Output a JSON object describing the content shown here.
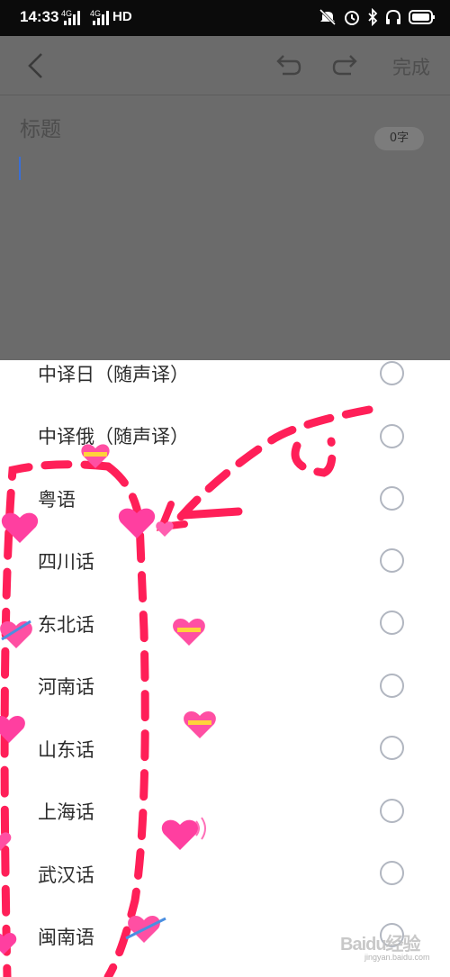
{
  "status_bar": {
    "time": "14:33",
    "network_1": "4G",
    "network_2": "4G",
    "hd_label": "HD"
  },
  "editor": {
    "done_label": "完成",
    "title_placeholder": "标题",
    "char_count": "0字"
  },
  "options": [
    {
      "label": "中译日（随声译）",
      "selected": false
    },
    {
      "label": "中译俄（随声译）",
      "selected": false
    },
    {
      "label": "粤语",
      "selected": false
    },
    {
      "label": "四川话",
      "selected": false
    },
    {
      "label": "东北话",
      "selected": false
    },
    {
      "label": "河南话",
      "selected": false
    },
    {
      "label": "山东话",
      "selected": false
    },
    {
      "label": "上海话",
      "selected": false
    },
    {
      "label": "武汉话",
      "selected": false
    },
    {
      "label": "闽南语",
      "selected": false
    }
  ],
  "watermark": {
    "main": "Baidu经验",
    "sub": "jingyan.baidu.com"
  },
  "colors": {
    "annotation_red": "#ff1f58",
    "radio_border": "#b1b6c0",
    "heart_pink": "#ff4fa3"
  }
}
